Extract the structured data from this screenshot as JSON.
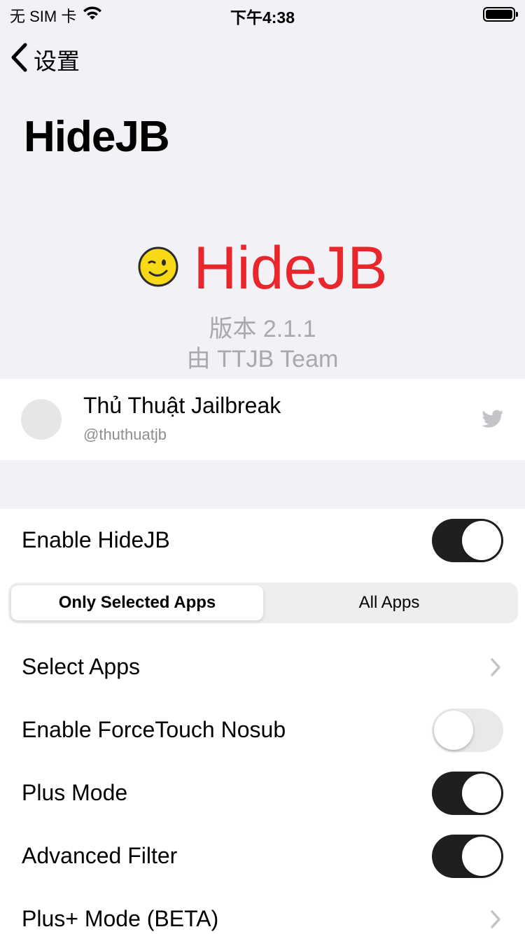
{
  "status_bar": {
    "carrier": "无 SIM 卡",
    "time": "下午4:38"
  },
  "nav": {
    "back_label": "设置"
  },
  "large_title": "HideJB",
  "header": {
    "name": "HideJB",
    "version": "版本 2.1.1",
    "author": "由 TTJB Team"
  },
  "twitter": {
    "name": "Thủ Thuật Jailbreak",
    "handle": "@thuthuatjb"
  },
  "settings": {
    "enable": {
      "label": "Enable HideJB",
      "on": true
    },
    "segmented": {
      "options": [
        "Only Selected Apps",
        "All Apps"
      ],
      "selected": 0
    },
    "select_apps": {
      "label": "Select Apps"
    },
    "force_touch": {
      "label": "Enable ForceTouch Nosub",
      "on": false
    },
    "plus_mode": {
      "label": "Plus Mode",
      "on": true
    },
    "advanced_filter": {
      "label": "Advanced Filter",
      "on": true
    },
    "plus_plus_mode": {
      "label": "Plus+ Mode (BETA)"
    }
  },
  "colors": {
    "accent": "#e8262b",
    "toggle_on": "#1f1f1f",
    "background": "#f2f1f6"
  }
}
